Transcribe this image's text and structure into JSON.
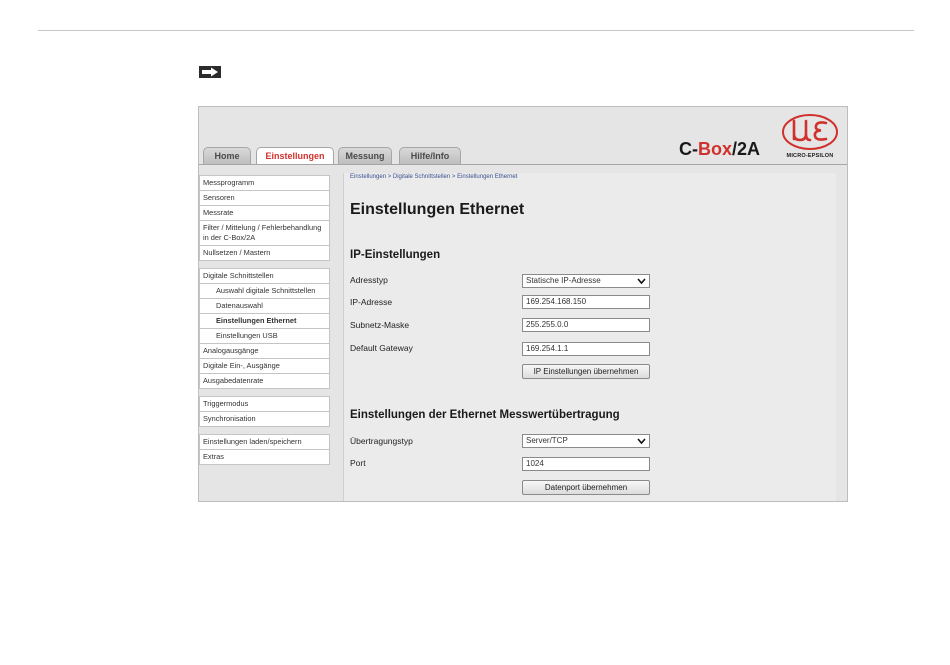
{
  "tabs": [
    {
      "label": "Home",
      "active": false
    },
    {
      "label": "Einstellungen",
      "active": true
    },
    {
      "label": "Messung",
      "active": false
    },
    {
      "label": "Hilfe/Info",
      "active": false
    }
  ],
  "product": {
    "prefix": "C-",
    "highlight": "Box",
    "suffix": "/2A"
  },
  "logo": {
    "text": "MICRO-EPSILON",
    "color": "#d0312d"
  },
  "sidebar": {
    "items": [
      {
        "label": "Messprogramm"
      },
      {
        "label": "Sensoren"
      },
      {
        "label": "Messrate"
      },
      {
        "label": "Filter / Mittelung / Fehlerbehandlung in der C-Box/2A"
      },
      {
        "label": "Nullsetzen / Mastern"
      },
      {
        "label": "Digitale Schnittstellen"
      },
      {
        "label": "Auswahl digitale Schnittstellen"
      },
      {
        "label": "Datenauswahl"
      },
      {
        "label": "Einstellungen Ethernet"
      },
      {
        "label": "Einstellungen USB"
      },
      {
        "label": "Analogausgänge"
      },
      {
        "label": "Digitale Ein-, Ausgänge"
      },
      {
        "label": "Ausgabedatenrate"
      },
      {
        "label": "Triggermodus"
      },
      {
        "label": "Synchronisation"
      },
      {
        "label": "Einstellungen laden/speichern"
      },
      {
        "label": "Extras"
      }
    ]
  },
  "main": {
    "breadcrumb": "Einstellungen > Digitale Schnittstellen > Einstellungen Ethernet",
    "title": "Einstellungen Ethernet",
    "ip_section": {
      "title": "IP-Einstellungen",
      "adresstyp_label": "Adresstyp",
      "adresstyp_value": "Statische IP-Adresse",
      "ip_label": "IP-Adresse",
      "ip_value": "169.254.168.150",
      "mask_label": "Subnetz-Maske",
      "mask_value": "255.255.0.0",
      "gateway_label": "Default Gateway",
      "gateway_value": "169.254.1.1",
      "apply_button": "IP Einstellungen übernehmen"
    },
    "transfer_section": {
      "title": "Einstellungen der Ethernet Messwertübertragung",
      "type_label": "Übertragungstyp",
      "type_value": "Server/TCP",
      "port_label": "Port",
      "port_value": "1024",
      "apply_button": "Datenport übernehmen"
    }
  },
  "colors": {
    "accent": "#d0312d",
    "breadcrumb": "#3a4f8f",
    "panel_bg": "#e5e5e5"
  }
}
